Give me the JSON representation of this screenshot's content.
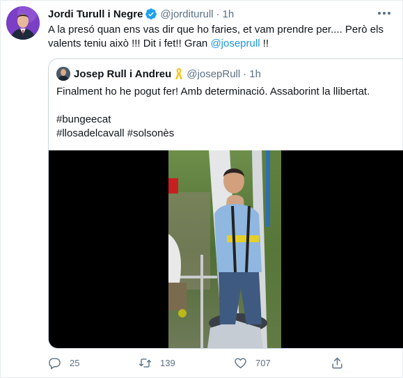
{
  "tweet": {
    "author_name": "Jordi Turull i Negre",
    "handle": "@jorditurull",
    "separator": "·",
    "time": "1h",
    "text_before_mention": "A la presó quan ens vas dir que ho faries, et vam prendre per.... Però els valents teniu això !!! Dit i fet!! Gran ",
    "mention": "@joseprull",
    "text_after_mention": " !!",
    "avatar_icon": "profile-photo",
    "verified_icon": "verified-badge-icon",
    "verified_color": "#1da1f2"
  },
  "quoted_tweet": {
    "author_name": "Josep Rull i Andreu",
    "ribbon_icon": "yellow-ribbon-icon",
    "ribbon_color": "#f5c518",
    "handle": "@josepRull",
    "separator": "·",
    "time": "1h",
    "lines": [
      "Finalment ho he pogut fer! Amb determinació. Assaborint la llibertat.",
      "#bungeecat",
      "#llosadelcavall #solsonès"
    ],
    "media_type": "video"
  },
  "actions": {
    "reply_count": "25",
    "retweet_count": "139",
    "like_count": "707",
    "reply_icon": "reply-icon",
    "retweet_icon": "retweet-icon",
    "like_icon": "heart-icon",
    "share_icon": "share-icon"
  },
  "colors": {
    "text": "#0f1419",
    "secondary": "#5b7083",
    "link": "#1b95e0",
    "border": "#ccd6dd"
  }
}
